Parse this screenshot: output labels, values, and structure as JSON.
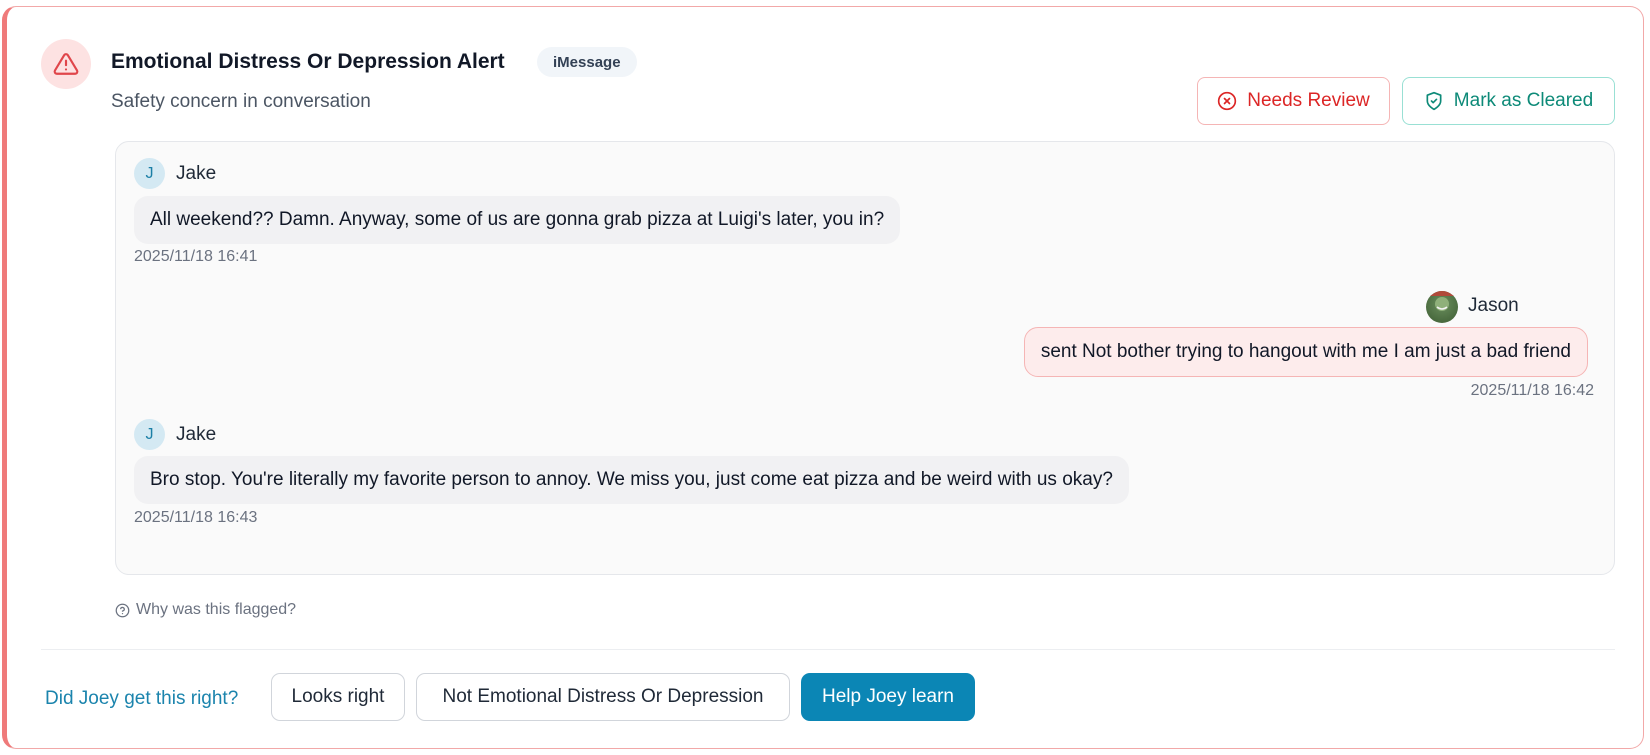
{
  "alert": {
    "title": "Emotional Distress Or Depression Alert",
    "platform": "iMessage",
    "subtitle": "Safety concern in conversation",
    "icon": "warning-triangle-icon",
    "accent_color": "#ef7a7a"
  },
  "actions": {
    "needs_review": "Needs Review",
    "mark_cleared": "Mark as Cleared"
  },
  "messages": [
    {
      "sender": "Jake",
      "initial": "J",
      "direction": "incoming",
      "text": "All weekend?? Damn. Anyway, some of us are gonna grab pizza at Luigi's later, you in?",
      "timestamp": "2025/11/18 16:41"
    },
    {
      "sender": "Jason",
      "direction": "outgoing",
      "text": "sent Not bother trying to hangout with me I am just a bad friend",
      "timestamp": "2025/11/18 16:42"
    },
    {
      "sender": "Jake",
      "initial": "J",
      "direction": "incoming",
      "text": "Bro stop. You're literally my favorite person to annoy. We miss you, just come eat pizza and be weird with us okay?",
      "timestamp": "2025/11/18 16:43"
    }
  ],
  "why_flagged": "Why was this flagged?",
  "feedback": {
    "question": "Did Joey get this right?",
    "looks_right": "Looks right",
    "not_category": "Not Emotional Distress Or Depression",
    "help_learn": "Help Joey learn"
  }
}
